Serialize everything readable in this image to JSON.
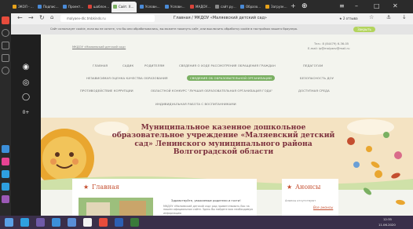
{
  "browser": {
    "tabs": [
      {
        "label": "ЭКОЛ - …"
      },
      {
        "label": "Подпис…"
      },
      {
        "label": "Проект…"
      },
      {
        "label": "шаблон…"
      },
      {
        "label": "Сайт. Х…"
      },
      {
        "label": "Условн…"
      },
      {
        "label": "Условн…"
      },
      {
        "label": "МАДОУ…"
      },
      {
        "label": "сайт.ру…"
      },
      {
        "label": "Образо…"
      },
      {
        "label": "Загрузк…"
      }
    ],
    "url": "malyaev-dlc.tmbkinds.ru",
    "page_title": "Главная / МКДОУ «Маляевский детский сад»",
    "reviews": "★ 2 отзыва"
  },
  "cookie": {
    "text": "Сайт использует cookie, если вы не хотите, что бы они обрабатывались, вы можете покинуть сайт, или выключить обработку cookie в настройках вашего браузера.",
    "accept": "Закрыть"
  },
  "header": {
    "site_name": "МКДОУ «Маляевский детский сад»",
    "phone": "Тел.: 8 (84479) 6-36-05",
    "email": "E-mail: ip@malyaev@mail.ru"
  },
  "nav": {
    "row1": [
      "ГЛАВНАЯ",
      "САДИК",
      "РОДИТЕЛЯМ",
      "СВЕДЕНИЯ О ХОДЕ РАССМОТРЕНИЯ ОБРАЩЕНИЯ ГРАЖДАН",
      "ПЕДАГОГАМ"
    ],
    "row2": [
      "НЕЗАВИСИМАЯ ОЦЕНКА КАЧЕСТВА ОБРАЗОВАНИЯ",
      "СВЕДЕНИЯ ОБ ОБРАЗОВАТЕЛЬНОЙ ОРГАНИЗАЦИИ",
      "БЕЗОПАСНОСТЬ ДОУ"
    ],
    "row3": [
      "ПРОТИВОДЕЙСТВИЕ КОРРУПЦИИ",
      "ОБЛАСТНОЙ КОНКУРС \"ЛУЧШАЯ ОБРАЗОВАТЕЛЬНАЯ ОРГАНИЗАЦИЯ ГОДА\"",
      "ДОСТУПНАЯ СРЕДА"
    ],
    "row4": [
      "ИНДИВИДУАЛЬНАЯ РАБОТА С ВОСПИТАННИКАМИ"
    ]
  },
  "banner": {
    "title": "Муниципальное казенное дошкольное образовательное учреждение «Маляевский детский сад» Ленинского муниципального района Волгоградской области"
  },
  "main_section": {
    "title": "Главная",
    "greeting": "Здравствуйте, уважаемые родители и гости!",
    "text": "МКДОУ «Маляевский детский сад» рад приветствовать Вас на нашем официальном сайте. Здесь Вы найдете всю необходимую информацию"
  },
  "announcements": {
    "title": "Анонсы",
    "empty": "Анонсы отсутствуют",
    "all": "Все анонсы"
  },
  "accessibility": {
    "zoom": "0+"
  },
  "taskbar": {
    "time": "12:35",
    "date": "11.06.2020"
  },
  "colors": {
    "accent": "#7ab062",
    "title": "#7b2f3c",
    "banner_bg": "#f4e3c2",
    "section_title": "#c44e2f"
  }
}
